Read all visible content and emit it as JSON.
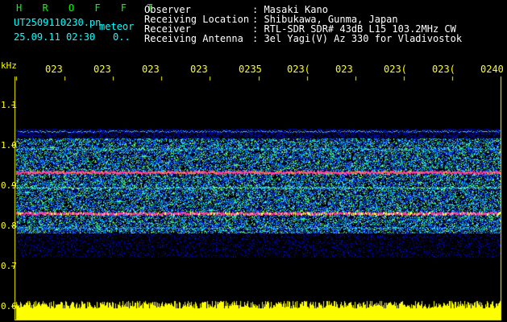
{
  "header": {
    "logo": "H R O F F T",
    "filename": "UT2509110230.pn",
    "filename_suffix": "meteor",
    "timestamp": "25.09.11 02:30",
    "timestamp_extra": "0..",
    "fields": [
      {
        "label": "Observer",
        "value": ": Masaki Kano"
      },
      {
        "label": "Receiving Location",
        "value": ": Shibukawa, Gunma, Japan"
      },
      {
        "label": "Receiver",
        "value": ": RTL-SDR SDR# 43dB L15 103.2MHz CW"
      },
      {
        "label": "Receiving Antenna",
        "value": ": 3el Yagi(V) Az 330 for Vladivostok"
      }
    ]
  },
  "axes": {
    "y_unit": "kHz",
    "y_ticks": [
      "1.1",
      "1.0",
      "0.9",
      "0.8",
      "0.7",
      "0.6"
    ],
    "x_ticks": [
      "023",
      "023",
      "023",
      "023",
      "0235",
      "023(",
      "023",
      "023(",
      "023(",
      "0240"
    ]
  },
  "colors": {
    "background": "#000000",
    "axis": "#ffff00",
    "noise_low": "#0000c8",
    "noise_mid": "#00c8ff",
    "noise_high": "#ffff00",
    "line_hot": "#ff3aa0",
    "amplitude": "#ffff00"
  }
}
